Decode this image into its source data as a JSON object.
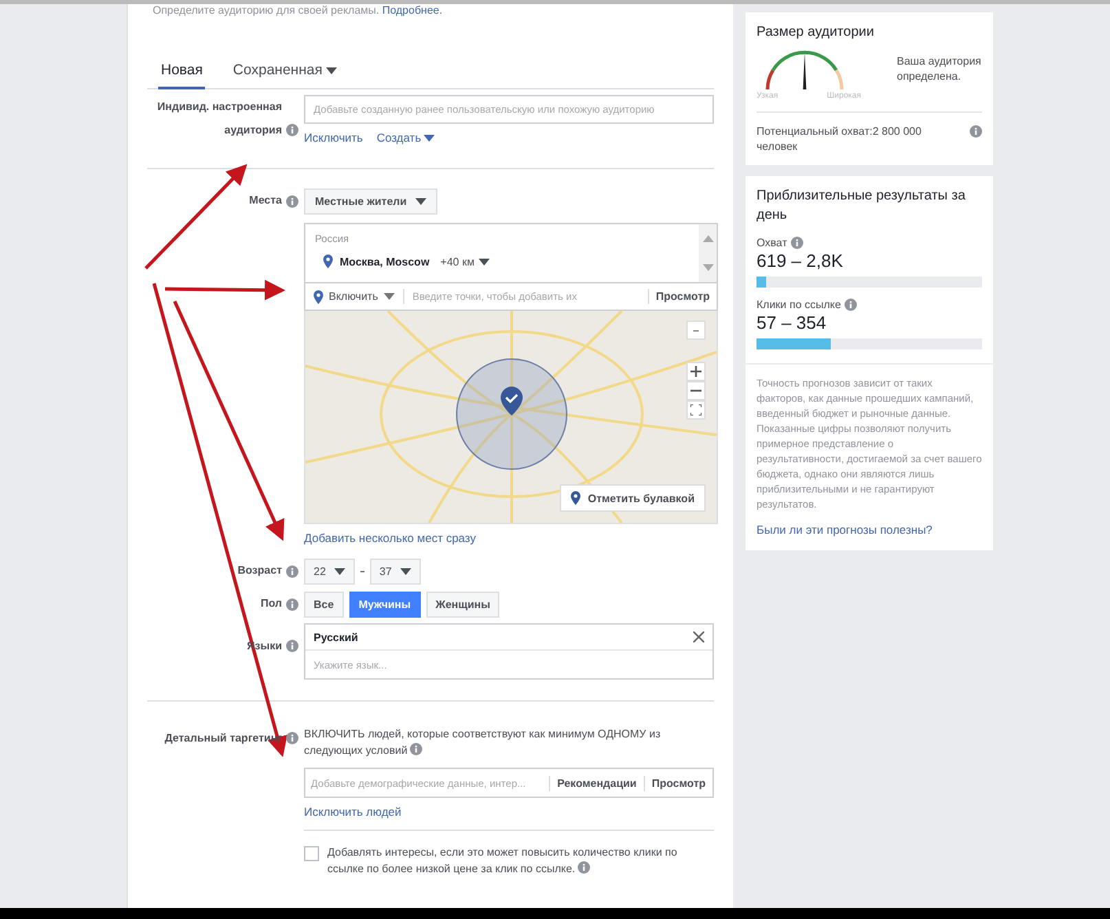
{
  "intro": {
    "text": "Определите аудиторию для своей рекламы.",
    "link": "Подробнее."
  },
  "tabs": [
    {
      "label": "Новая",
      "selected": true,
      "dropdown": false
    },
    {
      "label": "Сохраненная",
      "selected": false,
      "dropdown": true
    }
  ],
  "custom_audience": {
    "label": "Индивид. настроенная аудитория",
    "placeholder": "Добавьте созданную ранее пользовательскую или похожую аудиторию",
    "links": [
      {
        "label": "Исключить",
        "dropdown": false
      },
      {
        "label": "Создать",
        "dropdown": true
      }
    ]
  },
  "locations": {
    "label": "Места",
    "type_select": "Местные жители",
    "country": "Россия",
    "city": "Москва, Moscow",
    "radius": "+40 км",
    "include_select": "Включить",
    "placeholder": "Введите точки, чтобы добавить их",
    "browse": "Просмотр",
    "drop_pin": "Отметить булавкой",
    "bulk_link": "Добавить несколько мест сразу"
  },
  "age": {
    "label": "Возраст",
    "from": "22",
    "to": "37"
  },
  "gender": {
    "label": "Пол",
    "options": [
      {
        "label": "Все",
        "selected": false
      },
      {
        "label": "Мужчины",
        "selected": true
      },
      {
        "label": "Женщины",
        "selected": false
      }
    ]
  },
  "languages": {
    "label": "Языки",
    "selected": "Русский",
    "placeholder": "Укажите язык..."
  },
  "detailed_targeting": {
    "label": "Детальный таргетинг",
    "description": "ВКЛЮЧИТЬ людей, которые соответствуют как минимум ОДНОМУ из следующих условий",
    "placeholder": "Добавьте демографические данные, интер...",
    "suggestions": "Рекомендации",
    "browse": "Просмотр",
    "exclude_link": "Исключить людей",
    "expand_checkbox": {
      "label": "Добавлять интересы, если это может повысить количество клики по ссылке по более низкой цене за клик по ссылке.",
      "checked": false
    }
  },
  "audience_size": {
    "title": "Размер аудитории",
    "narrow": "Узкая",
    "broad": "Широкая",
    "status": "Ваша аудитория определена.",
    "reach": "Потенциальный охват:2 800 000 человек"
  },
  "estimated_results": {
    "title": "Приблизительные результаты за день",
    "metrics": [
      {
        "label": "Охват",
        "value": "619 – 2,8K",
        "level": 0.04
      },
      {
        "label": "Клики по ссылке",
        "value": "57 – 354",
        "level": 0.33
      }
    ],
    "disclaimer": "Точность прогнозов зависит от таких факторов, как данные прошедших кампаний, введенный бюджет и рыночные данные. Показанные цифры позволяют получить примерное представление о результативности, достигаемой за счет вашего бюджета, однако они являются лишь приблизительными и не гарантируют результатов.",
    "feedback_link": "Были ли эти прогнозы полезны?"
  }
}
